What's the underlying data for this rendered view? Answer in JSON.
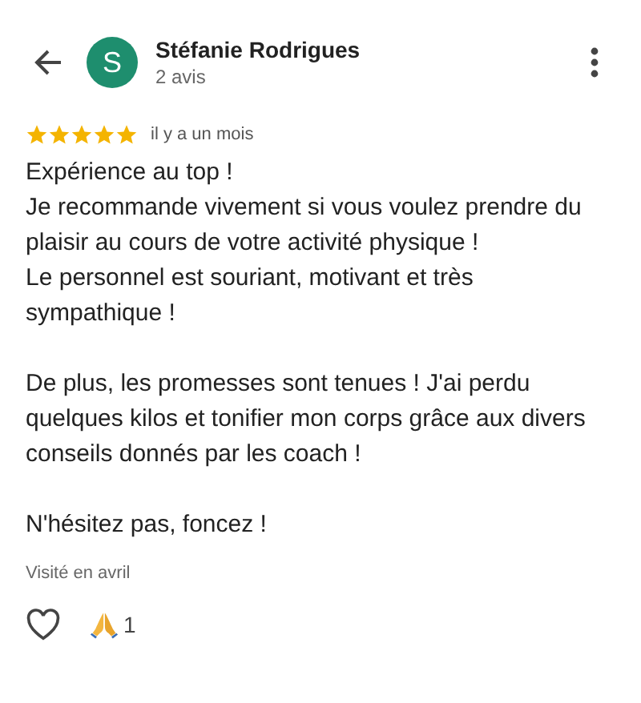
{
  "reviewer": {
    "initial": "S",
    "color": "#1e8e6e",
    "name": "Stéfanie Rodrigues",
    "reviews": "2 avis"
  },
  "review": {
    "stars": 5,
    "time": "il y a un mois",
    "paragraphs": [
      [
        "Expérience au top !",
        "Je recommande vivement si vous voulez prendre du plaisir au cours de votre activité physique !",
        "Le personnel est souriant, motivant et très sympathique !"
      ],
      [
        "De plus, les promesses sont tenues ! J'ai perdu quelques kilos et tonifier mon corps grâce aux divers conseils donnés par les coach !"
      ],
      [
        "N'hésitez pas, foncez !"
      ]
    ],
    "visited": "Visité en avril",
    "reactions": [
      {
        "kind": "like",
        "selected": false
      },
      {
        "kind": "thanks",
        "count": "1"
      }
    ]
  }
}
